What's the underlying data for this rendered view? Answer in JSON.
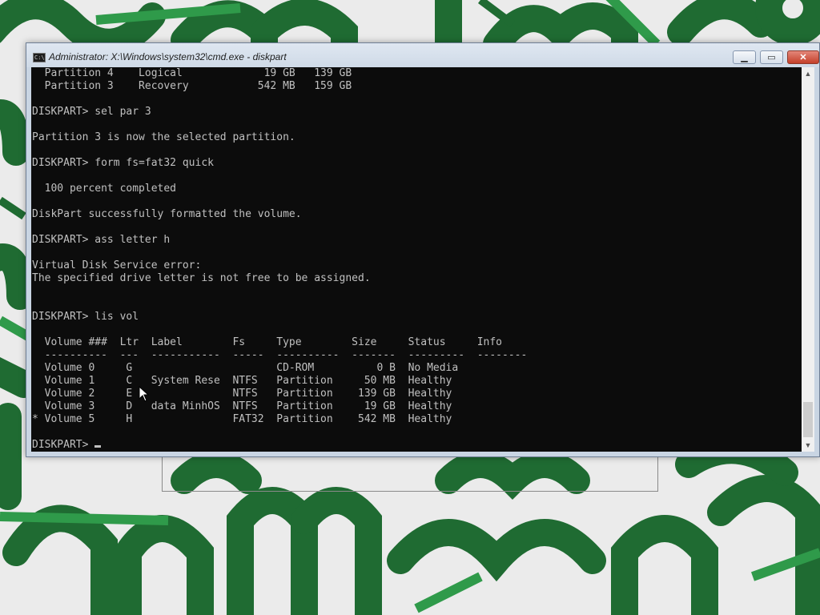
{
  "window": {
    "title": "Administrator: X:\\Windows\\system32\\cmd.exe - diskpart",
    "icon": "cmd-app-icon",
    "buttons": {
      "minimize": "▁",
      "maximize": "▭",
      "close": "✕"
    }
  },
  "console": {
    "lines": [
      "  Partition 4    Logical             19 GB   139 GB",
      "  Partition 3    Recovery           542 MB   159 GB",
      "",
      "DISKPART> sel par 3",
      "",
      "Partition 3 is now the selected partition.",
      "",
      "DISKPART> form fs=fat32 quick",
      "",
      "  100 percent completed",
      "",
      "DiskPart successfully formatted the volume.",
      "",
      "DISKPART> ass letter h",
      "",
      "Virtual Disk Service error:",
      "The specified drive letter is not free to be assigned.",
      "",
      "",
      "DISKPART> lis vol",
      "",
      "  Volume ###  Ltr  Label        Fs     Type        Size     Status     Info",
      "  ----------  ---  -----------  -----  ----------  -------  ---------  --------",
      "  Volume 0     G                       CD-ROM          0 B  No Media",
      "  Volume 1     C   System Rese  NTFS   Partition     50 MB  Healthy",
      "  Volume 2     E                NTFS   Partition    139 GB  Healthy",
      "  Volume 3     D   data MinhOS  NTFS   Partition     19 GB  Healthy",
      "* Volume 5     H                FAT32  Partition    542 MB  Healthy",
      ""
    ],
    "prompt": "DISKPART> "
  },
  "colors": {
    "console_bg": "#0c0c0c",
    "console_fg": "#c0c0c0",
    "wallpaper_green_dark": "#1f6b32",
    "wallpaper_green_light": "#2f9a4a",
    "wallpaper_bg": "#ebebeb"
  }
}
